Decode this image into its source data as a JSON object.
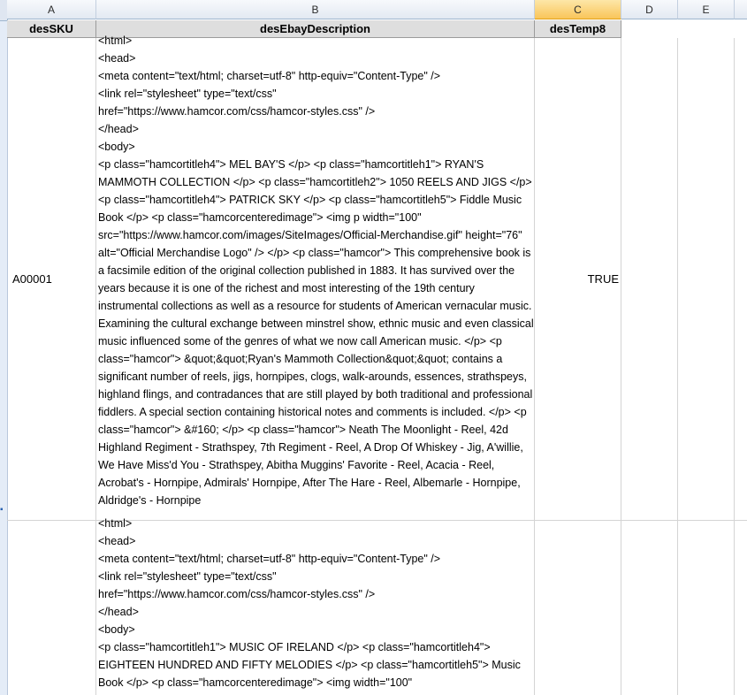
{
  "columns": {
    "a": "A",
    "b": "B",
    "c": "C",
    "d": "D",
    "e": "E"
  },
  "headers": {
    "a": "desSKU",
    "b": "desEbayDescription",
    "c": "desTemp8"
  },
  "rows": [
    {
      "sku": "A00001",
      "temp8": "TRUE",
      "description": "<html>\n<head>\n<meta content=\"text/html; charset=utf-8\" http-equiv=\"Content-Type\" />\n<link rel=\"stylesheet\" type=\"text/css\"\nhref=\"https://www.hamcor.com/css/hamcor-styles.css\" />\n</head>\n<body>\n<p class=\"hamcortitleh4\"> MEL BAY'S </p> <p class=\"hamcortitleh1\"> RYAN'S MAMMOTH COLLECTION </p> <p class=\"hamcortitleh2\"> 1050 REELS AND JIGS </p> <p class=\"hamcortitleh4\"> PATRICK SKY </p> <p class=\"hamcortitleh5\"> Fiddle Music Book </p> <p class=\"hamcorcenteredimage\"> <img p width=\"100\" src=\"https://www.hamcor.com/images/SiteImages/Official-Merchandise.gif\" height=\"76\" alt=\"Official Merchandise Logo\" /> </p> <p class=\"hamcor\"> This comprehensive book is a facsimile edition of the original collection published in 1883. It has survived over the years because it is one of the richest and most interesting of the 19th century instrumental collections as well as a resource for students of American vernacular music. Examining the cultural exchange between minstrel show, ethnic music and even classical music influenced some of the genres of what we now call American music. </p> <p class=\"hamcor\"> &quot;&quot;Ryan's Mammoth Collection&quot;&quot; contains a significant number of reels, jigs, hornpipes, clogs, walk-arounds, essences, strathspeys, highland flings, and contradances that are still played by both traditional and professional fiddlers. A special section containing historical notes and comments is included. </p> <p class=\"hamcor\"> &#160; </p> <p class=\"hamcor\"> Neath The Moonlight - Reel, 42d Highland Regiment - Strathspey, 7th Regiment - Reel, A Drop Of Whiskey - Jig, A'willie, We Have Miss'd You - Strathspey, Abitha Muggins' Favorite - Reel, Acacia - Reel, Acrobat's - Hornpipe, Admirals' Hornpipe, After The Hare - Reel, Albemarle - Hornpipe, Aldridge's - Hornpipe"
    },
    {
      "sku": "",
      "temp8": "",
      "description": "<html>\n<head>\n<meta content=\"text/html; charset=utf-8\" http-equiv=\"Content-Type\" />\n<link rel=\"stylesheet\" type=\"text/css\"\nhref=\"https://www.hamcor.com/css/hamcor-styles.css\" />\n</head>\n<body>\n<p class=\"hamcortitleh1\"> MUSIC OF IRELAND </p> <p class=\"hamcortitleh4\"> EIGHTEEN HUNDRED AND FIFTY MELODIES </p> <p class=\"hamcortitleh5\"> Music Book </p> <p class=\"hamcorcenteredimage\"> <img width=\"100\""
    }
  ]
}
